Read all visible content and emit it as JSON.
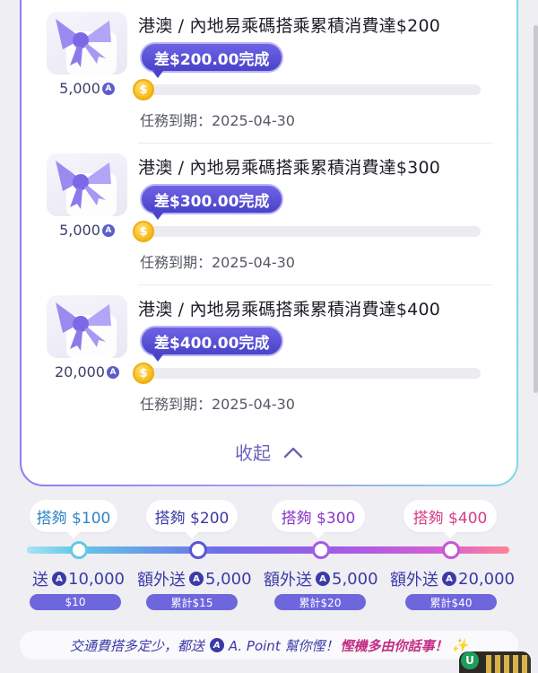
{
  "tasks": [
    {
      "title": "港澳 / 內地易乘碼搭乘累積消費達$200",
      "reward_points": "5,000",
      "gap_label": "差$200.00完成",
      "progress": 0.0,
      "deadline": "任務到期：2025-04-30"
    },
    {
      "title": "港澳 / 內地易乘碼搭乘累積消費達$300",
      "reward_points": "5,000",
      "gap_label": "差$300.00完成",
      "progress": 0.0,
      "deadline": "任務到期：2025-04-30"
    },
    {
      "title": "港澳 / 內地易乘碼搭乘累積消費達$400",
      "reward_points": "20,000",
      "gap_label": "差$400.00完成",
      "progress": 0.0,
      "deadline": "任務到期：2025-04-30"
    }
  ],
  "collapse_label": "收起",
  "milestones": [
    {
      "tier": "搭夠 $100",
      "tier_color": "#2f86c9",
      "bonus_prefix": "送",
      "bonus_points": "10,000",
      "cumulative": "$10"
    },
    {
      "tier": "搭夠 $200",
      "tier_color": "#3c3aa6",
      "bonus_prefix": "額外送",
      "bonus_points": "5,000",
      "cumulative": "累計$15"
    },
    {
      "tier": "搭夠 $300",
      "tier_color": "#8a36c8",
      "bonus_prefix": "額外送",
      "bonus_points": "5,000",
      "cumulative": "累計$20"
    },
    {
      "tier": "搭夠 $400",
      "tier_color": "#d23e86",
      "bonus_prefix": "額外送",
      "bonus_points": "20,000",
      "cumulative": "累計$40"
    }
  ],
  "banner": {
    "text1": "交通費搭多定少，都送",
    "text2": "A. Point 幫你慳！",
    "text3": "慳機多由你話事！"
  },
  "coin_glyph": "$",
  "a_glyph": "A",
  "float_badge": "U",
  "colors": {
    "accent": "#5b55d6",
    "card_border": "#8c7ef0",
    "coin": "#f3c233",
    "background": "#efeef3"
  },
  "icons": [
    "gift-icon",
    "a-point-icon",
    "coin-icon",
    "chevron-up-icon",
    "sparkle-icon"
  ]
}
